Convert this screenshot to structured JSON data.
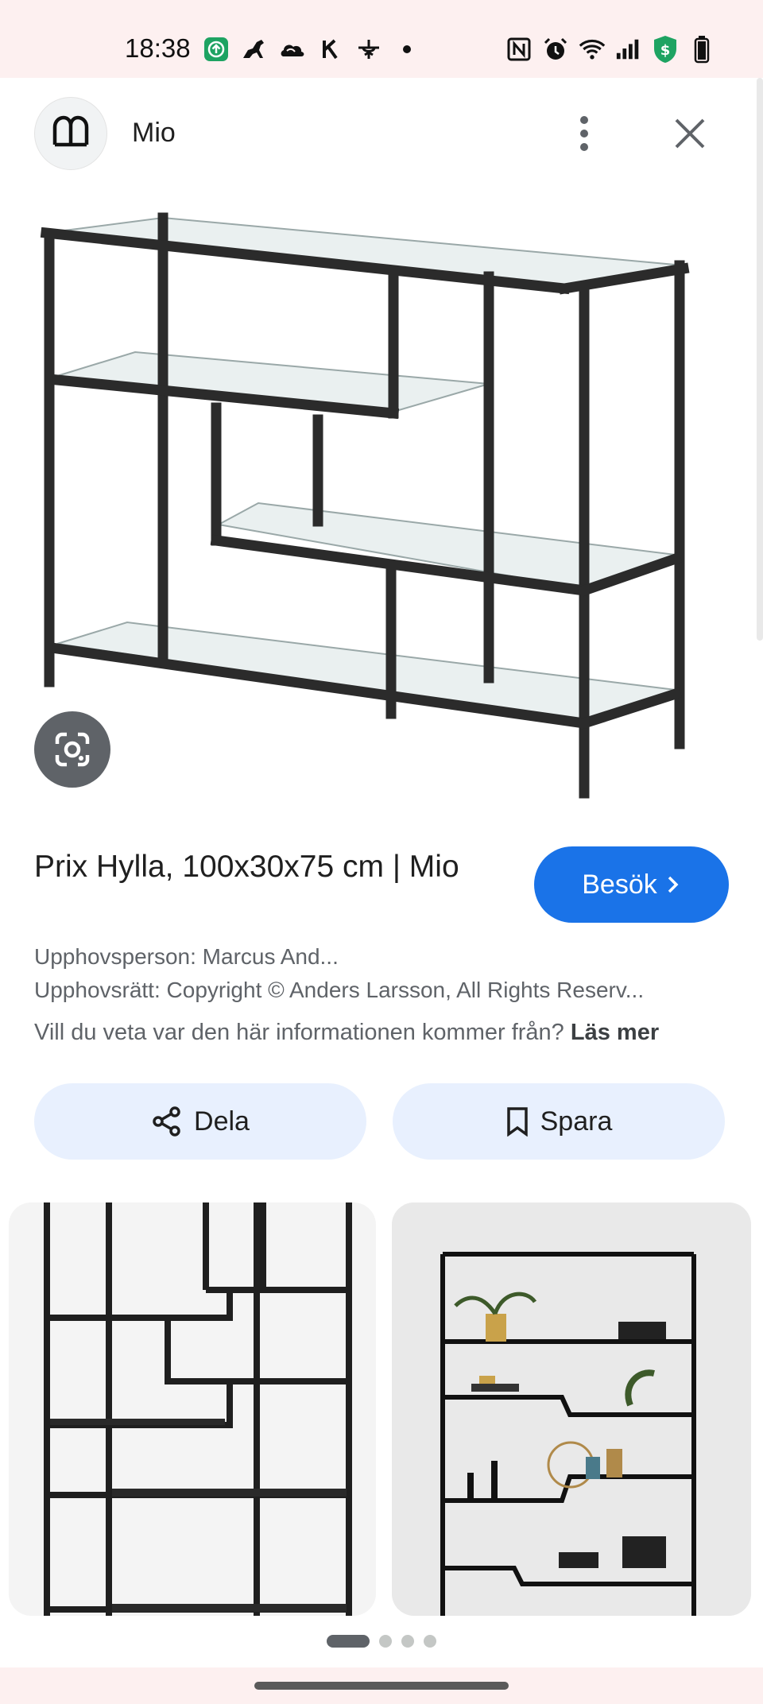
{
  "status_bar": {
    "time": "18:38",
    "left_icons": [
      "upload-app-icon",
      "horse-app-icon",
      "cloud-app-icon",
      "k-app-icon",
      "plane-app-icon",
      "dot-icon"
    ],
    "right_icons": [
      "nfc-icon",
      "alarm-icon",
      "wifi-icon",
      "signal-icon",
      "shield-dollar-icon",
      "battery-icon"
    ]
  },
  "header": {
    "site_name": "Mio"
  },
  "product": {
    "title": "Prix Hylla, 100x30x75 cm | Mio",
    "visit_label": "Besök",
    "author": "Upphovsperson: Marcus And...",
    "copyright": "Upphovsrätt: Copyright © Anders Larsson, All Rights Reserv...",
    "info_text": "Vill du veta var den här informationen kommer från?",
    "info_link": "Läs mer"
  },
  "actions": {
    "share_label": "Dela",
    "save_label": "Spara"
  },
  "pager": {
    "pages": 4,
    "active": 1
  },
  "colors": {
    "accent": "#1a73e8",
    "action_bg": "#e8f0fe",
    "status_bg": "#fdf0f0",
    "shelf_frame": "#2b2b2b"
  }
}
